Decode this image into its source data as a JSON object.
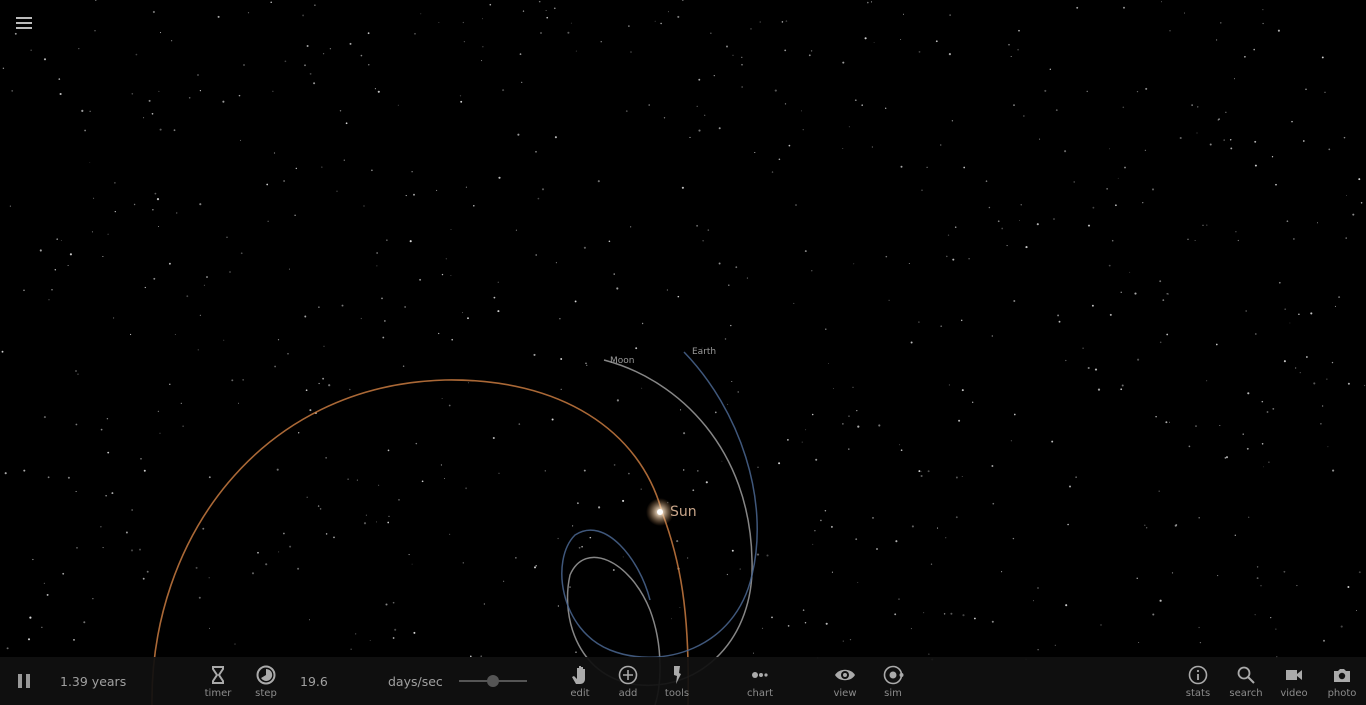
{
  "scene": {
    "bodies": [
      {
        "name": "Sun",
        "color": "#e08a4a"
      },
      {
        "name": "Moon",
        "color": "#b0b0b0"
      },
      {
        "name": "Earth",
        "color": "#4a6690"
      }
    ]
  },
  "toolbar": {
    "elapsed": "1.39 years",
    "timer_label": "timer",
    "step_label": "step",
    "rate_value": "19.6",
    "rate_unit": "days/sec",
    "rate_slider_fraction": 0.5,
    "edit_label": "edit",
    "add_label": "add",
    "tools_label": "tools",
    "chart_label": "chart",
    "view_label": "view",
    "sim_label": "sim",
    "stats_label": "stats",
    "search_label": "search",
    "video_label": "video",
    "photo_label": "photo"
  }
}
